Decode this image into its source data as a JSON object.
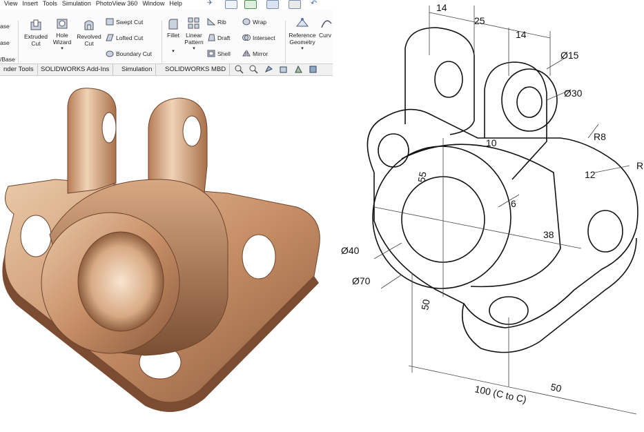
{
  "menu": [
    "View",
    "Insert",
    "Tools",
    "Simulation",
    "PhotoView 360",
    "Window",
    "Help"
  ],
  "ribbon": {
    "left_partial": [
      "ase",
      "ase",
      "/Base"
    ],
    "extruded_cut": [
      "Extruded",
      "Cut"
    ],
    "hole_wizard": [
      "Hole",
      "Wizard"
    ],
    "revolved_cut": [
      "Revolved",
      "Cut"
    ],
    "swept_cut": "Swept Cut",
    "lofted_cut": "Lofted Cut",
    "boundary_cut": "Boundary Cut",
    "fillet": "Fillet",
    "linear_pattern": [
      "Linear",
      "Pattern"
    ],
    "rib": "Rib",
    "draft": "Draft",
    "shell": "Shell",
    "wrap": "Wrap",
    "intersect": "Intersect",
    "mirror": "Mirror",
    "reference_geometry": [
      "Reference",
      "Geometry"
    ],
    "curves_partial": "Curv"
  },
  "tabs": [
    "nder Tools",
    "SOLIDWORKS Add-Ins",
    "Simulation",
    "SOLIDWORKS MBD"
  ],
  "drawing": {
    "dims": {
      "d14a": "14",
      "d25": "25",
      "d14b": "14",
      "d15": "Ø15",
      "d30": "Ø30",
      "r8": "R8",
      "d10": "10",
      "d12": "12",
      "d55": "55",
      "d6": "6",
      "d38": "38",
      "d40": "Ø40",
      "d70": "Ø70",
      "d50v": "50",
      "d100": "100 (C to C)",
      "d50h": "50",
      "rpartial": "R"
    }
  },
  "colors": {
    "copper_light": "#e8c2a0",
    "copper_mid": "#c8916a",
    "copper_dark": "#8a5a3a",
    "ink": "#111111"
  }
}
